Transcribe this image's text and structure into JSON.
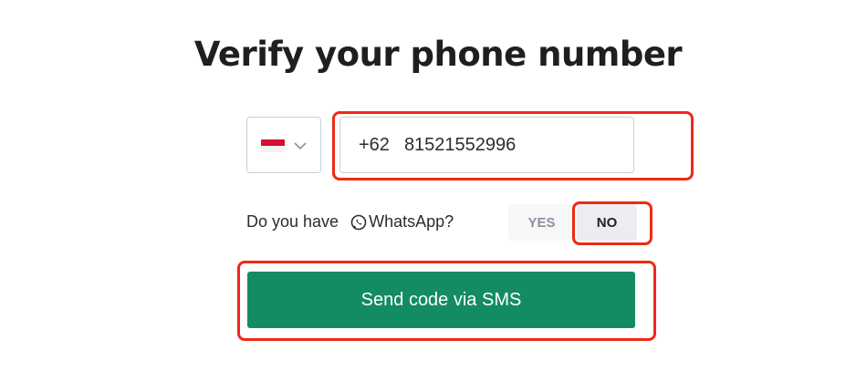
{
  "page": {
    "title": "Verify your phone number"
  },
  "country_select": {
    "flag": "indonesia-flag",
    "flag_colors": [
      "#d21034",
      "#f3f3f3"
    ],
    "icon": "chevron-down-icon"
  },
  "phone_input": {
    "country_code": "+62",
    "value": "81521552996"
  },
  "whatsapp": {
    "question_prefix": "Do you have",
    "icon": "whatsapp-icon",
    "question_suffix": "WhatsApp?",
    "yes_label": "YES",
    "no_label": "NO",
    "selected": "NO"
  },
  "send_button": {
    "label": "Send code via SMS",
    "color": "#138c63"
  },
  "annotations": {
    "highlight_color": "#ee2a16"
  }
}
